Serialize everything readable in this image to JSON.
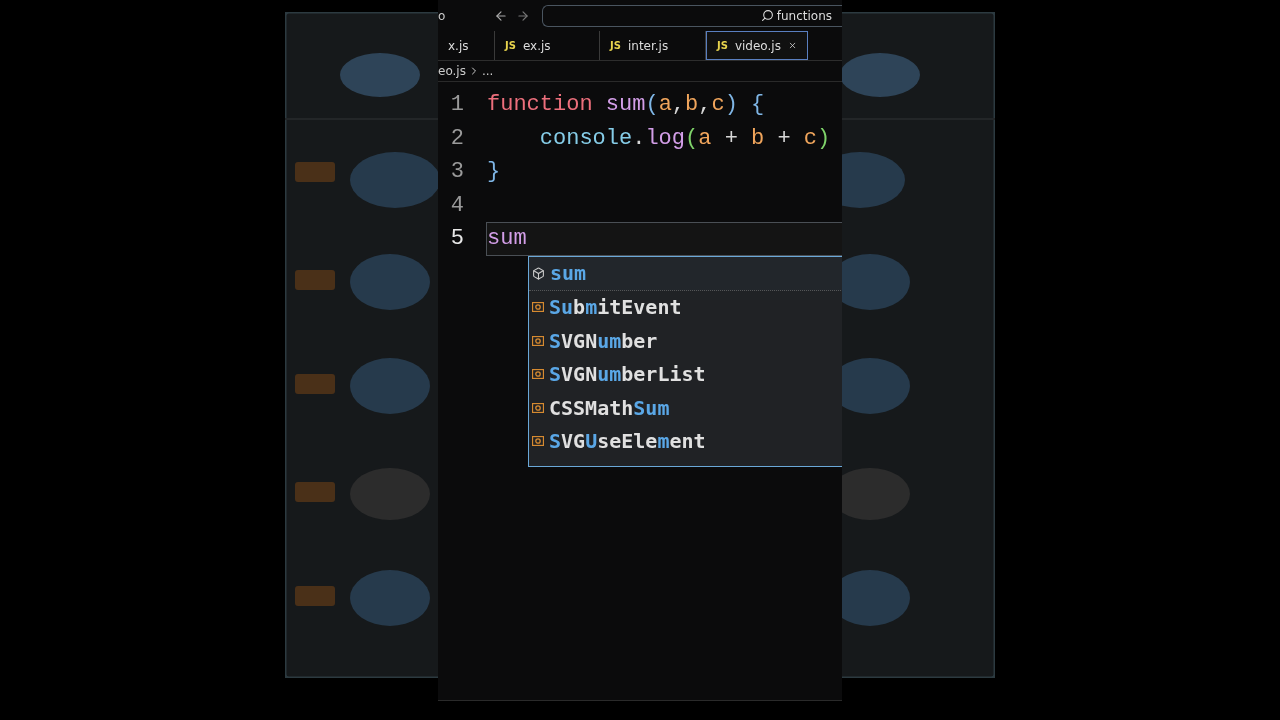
{
  "title_bar": {
    "title": "o",
    "search": {
      "value": "functions"
    }
  },
  "tabs": [
    {
      "label": "x.js",
      "selected": false
    },
    {
      "label": "ex.js",
      "badge": "JS",
      "selected": false
    },
    {
      "label": "inter.js",
      "badge": "JS",
      "selected": false
    },
    {
      "label": "video.js",
      "badge": "JS",
      "selected": true
    }
  ],
  "breadcrumb": [
    "eo.js",
    "..."
  ],
  "code_lines": [
    {
      "number": "1",
      "current": false,
      "tokens": [
        {
          "kind": "keyword",
          "text": "function"
        },
        {
          "kind": "function",
          "text": "sum",
          "space": true
        },
        {
          "kind": "bracket",
          "text": "("
        },
        {
          "kind": "param",
          "text": "a"
        },
        {
          "kind": "plain",
          "text": ","
        },
        {
          "kind": "param",
          "text": "b"
        },
        {
          "kind": "plain",
          "text": ","
        },
        {
          "kind": "param",
          "text": "c"
        },
        {
          "kind": "bracket",
          "text": ")"
        },
        {
          "kind": "bracket",
          "text": "{",
          "space": true
        }
      ]
    },
    {
      "number": "2",
      "current": false,
      "indented": true,
      "tokens": [
        {
          "kind": "variable",
          "text": "console"
        },
        {
          "kind": "plain",
          "text": "."
        },
        {
          "kind": "function",
          "text": "log"
        },
        {
          "kind": "bracket2",
          "text": "("
        },
        {
          "kind": "param",
          "text": "a"
        },
        {
          "kind": "plain",
          "text": "+",
          "space": true
        },
        {
          "kind": "param",
          "text": "b",
          "space": true
        },
        {
          "kind": "plain",
          "text": "+",
          "space": true
        },
        {
          "kind": "param",
          "text": "c",
          "space": true
        },
        {
          "kind": "bracket2",
          "text": ")"
        }
      ]
    },
    {
      "number": "3",
      "current": false,
      "tokens": [
        {
          "kind": "bracket",
          "text": "}"
        }
      ]
    },
    {
      "number": "4",
      "current": false
    },
    {
      "number": "5",
      "current": true,
      "tokens": [
        {
          "kind": "function",
          "text": "sum"
        }
      ]
    }
  ],
  "suggestions": [
    {
      "kind": "module",
      "label": "**sum**",
      "selected": true
    },
    {
      "kind": "variable",
      "label": "**Su**b**m**itEvent",
      "selected": false
    },
    {
      "kind": "variable",
      "label": "**S**VGN**um**ber",
      "selected": false
    },
    {
      "kind": "variable",
      "label": "**S**VGN**um**berList",
      "selected": false
    },
    {
      "kind": "variable",
      "label": "CSSMath**Sum**",
      "selected": false
    },
    {
      "kind": "variable",
      "label": "**S**VG**U**seEle**m**ent",
      "selected": false
    }
  ]
}
